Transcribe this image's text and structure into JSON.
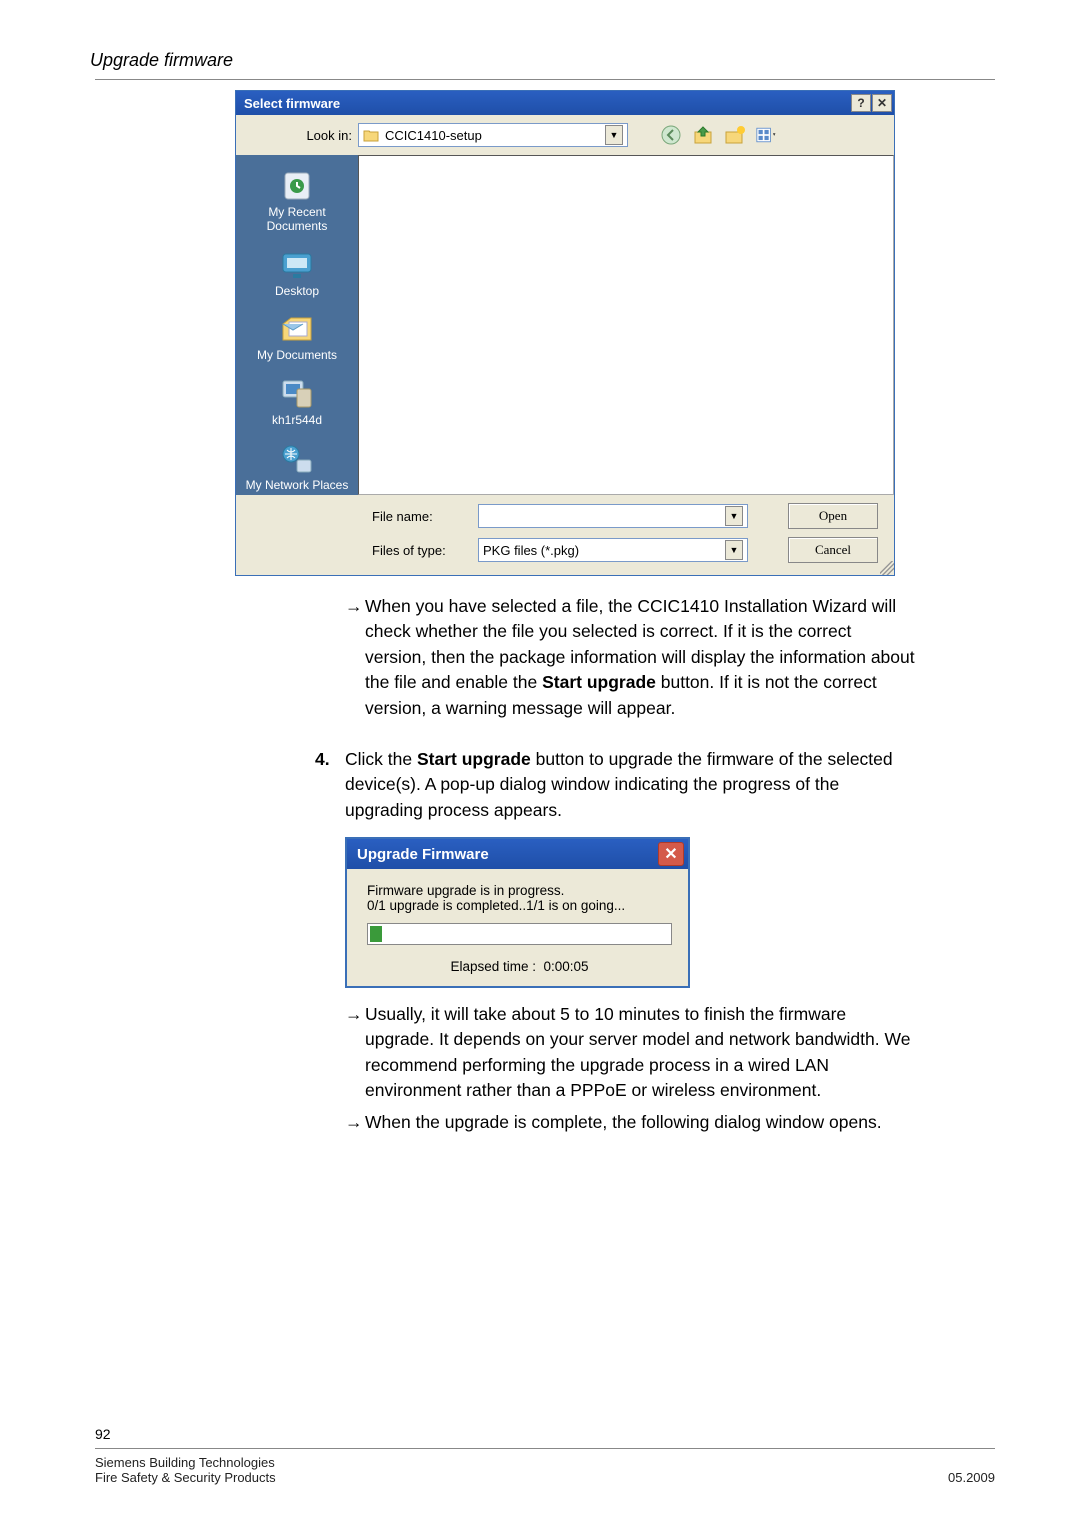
{
  "section_title": "Upgrade firmware",
  "file_dialog": {
    "title": "Select firmware",
    "lookin_label": "Look in:",
    "lookin_value": "CCIC1410-setup",
    "sidebar": [
      "My Recent Documents",
      "Desktop",
      "My Documents",
      "kh1r544d",
      "My Network Places"
    ],
    "file_name_label": "File name:",
    "file_name_value": "",
    "file_type_label": "Files of type:",
    "file_type_value": "PKG files (*.pkg)",
    "open_btn": "Open",
    "cancel_btn": "Cancel",
    "toolbar_icons": [
      "back-icon",
      "up-icon",
      "new-folder-icon",
      "views-icon"
    ]
  },
  "para1_prefix": "When you have selected a file, the CCIC1410 Installation Wizard will check whether the file you selected is correct. If it is the correct version, then the package information will display the information about the file and enable the ",
  "para1_bold": "Start upgrade",
  "para1_suffix": " button. If it is not the correct version, a warning message will appear.",
  "step_num": "4.",
  "step4_prefix": "Click the ",
  "step4_bold": "Start upgrade",
  "step4_suffix": " button to upgrade the firmware of the selected device(s). A pop-up dialog window indicating the progress of the upgrading process appears.",
  "uf_popup": {
    "title": "Upgrade Firmware",
    "line1": "Firmware upgrade is in progress.",
    "line2": "0/1 upgrade is completed..1/1 is on going...",
    "elapsed_label": "Elapsed time :",
    "elapsed_value": "0:00:05"
  },
  "para2": "Usually, it will take about 5 to 10 minutes to finish the firmware upgrade. It depends on your server model and network bandwidth. We recommend performing the upgrade process in a wired LAN environment rather than a PPPoE or wireless environment.",
  "para3": "When the upgrade is complete, the following dialog window opens.",
  "footer": {
    "page": "92",
    "left1": "Siemens Building Technologies",
    "left2": "Fire Safety & Security Products",
    "right": "05.2009"
  }
}
